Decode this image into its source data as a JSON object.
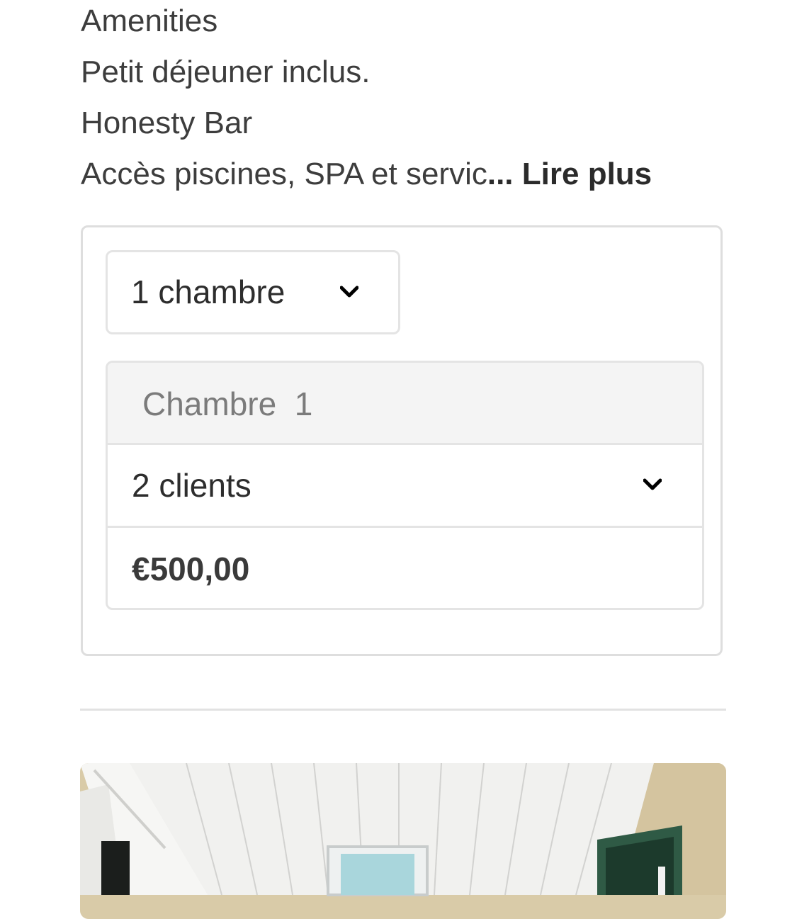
{
  "amenities": {
    "heading": "Amenities",
    "lines": [
      "Petit déjeuner inclus.",
      "Honesty Bar",
      "Accès piscines, SPA et servic"
    ],
    "ellipsis": "...",
    "read_more": "Lire plus"
  },
  "booking": {
    "room_count": "1 chambre",
    "room_header": "Chambre  1",
    "guests": "2 clients",
    "price": "€500,00"
  },
  "icons": {
    "dropdown": "chevron-down-icon"
  },
  "colors": {
    "text": "#3a3a3a",
    "border": "#e4e4e4",
    "header_bg": "#f4f4f4",
    "muted": "#7b7b7b",
    "door_green": "#2f5a45"
  }
}
